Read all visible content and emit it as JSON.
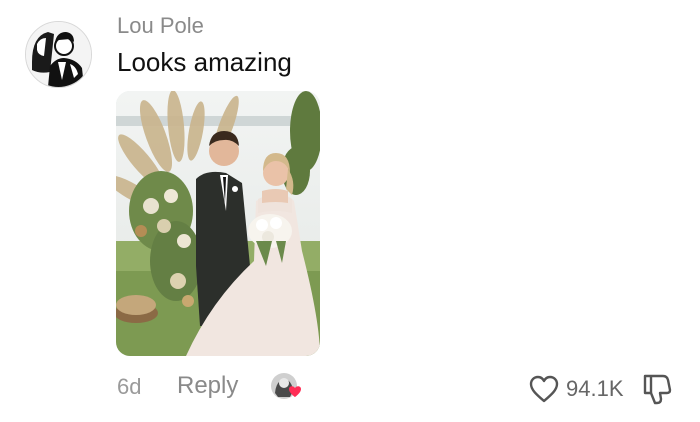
{
  "comment": {
    "username": "Lou Pole",
    "text": "Looks amazing",
    "timestamp": "6d",
    "reply_label": "Reply",
    "like_count": "94.1K"
  },
  "icons": {
    "avatar": "user-avatar",
    "photo": "wedding-photo",
    "liked_by": "creator-liked-badge",
    "like": "heart-outline-icon",
    "dislike": "thumbs-down-outline-icon"
  },
  "colors": {
    "username": "#8a8a8a",
    "text": "#111111",
    "heart_badge": "#ff2d55",
    "meta": "#9a9a9a"
  }
}
